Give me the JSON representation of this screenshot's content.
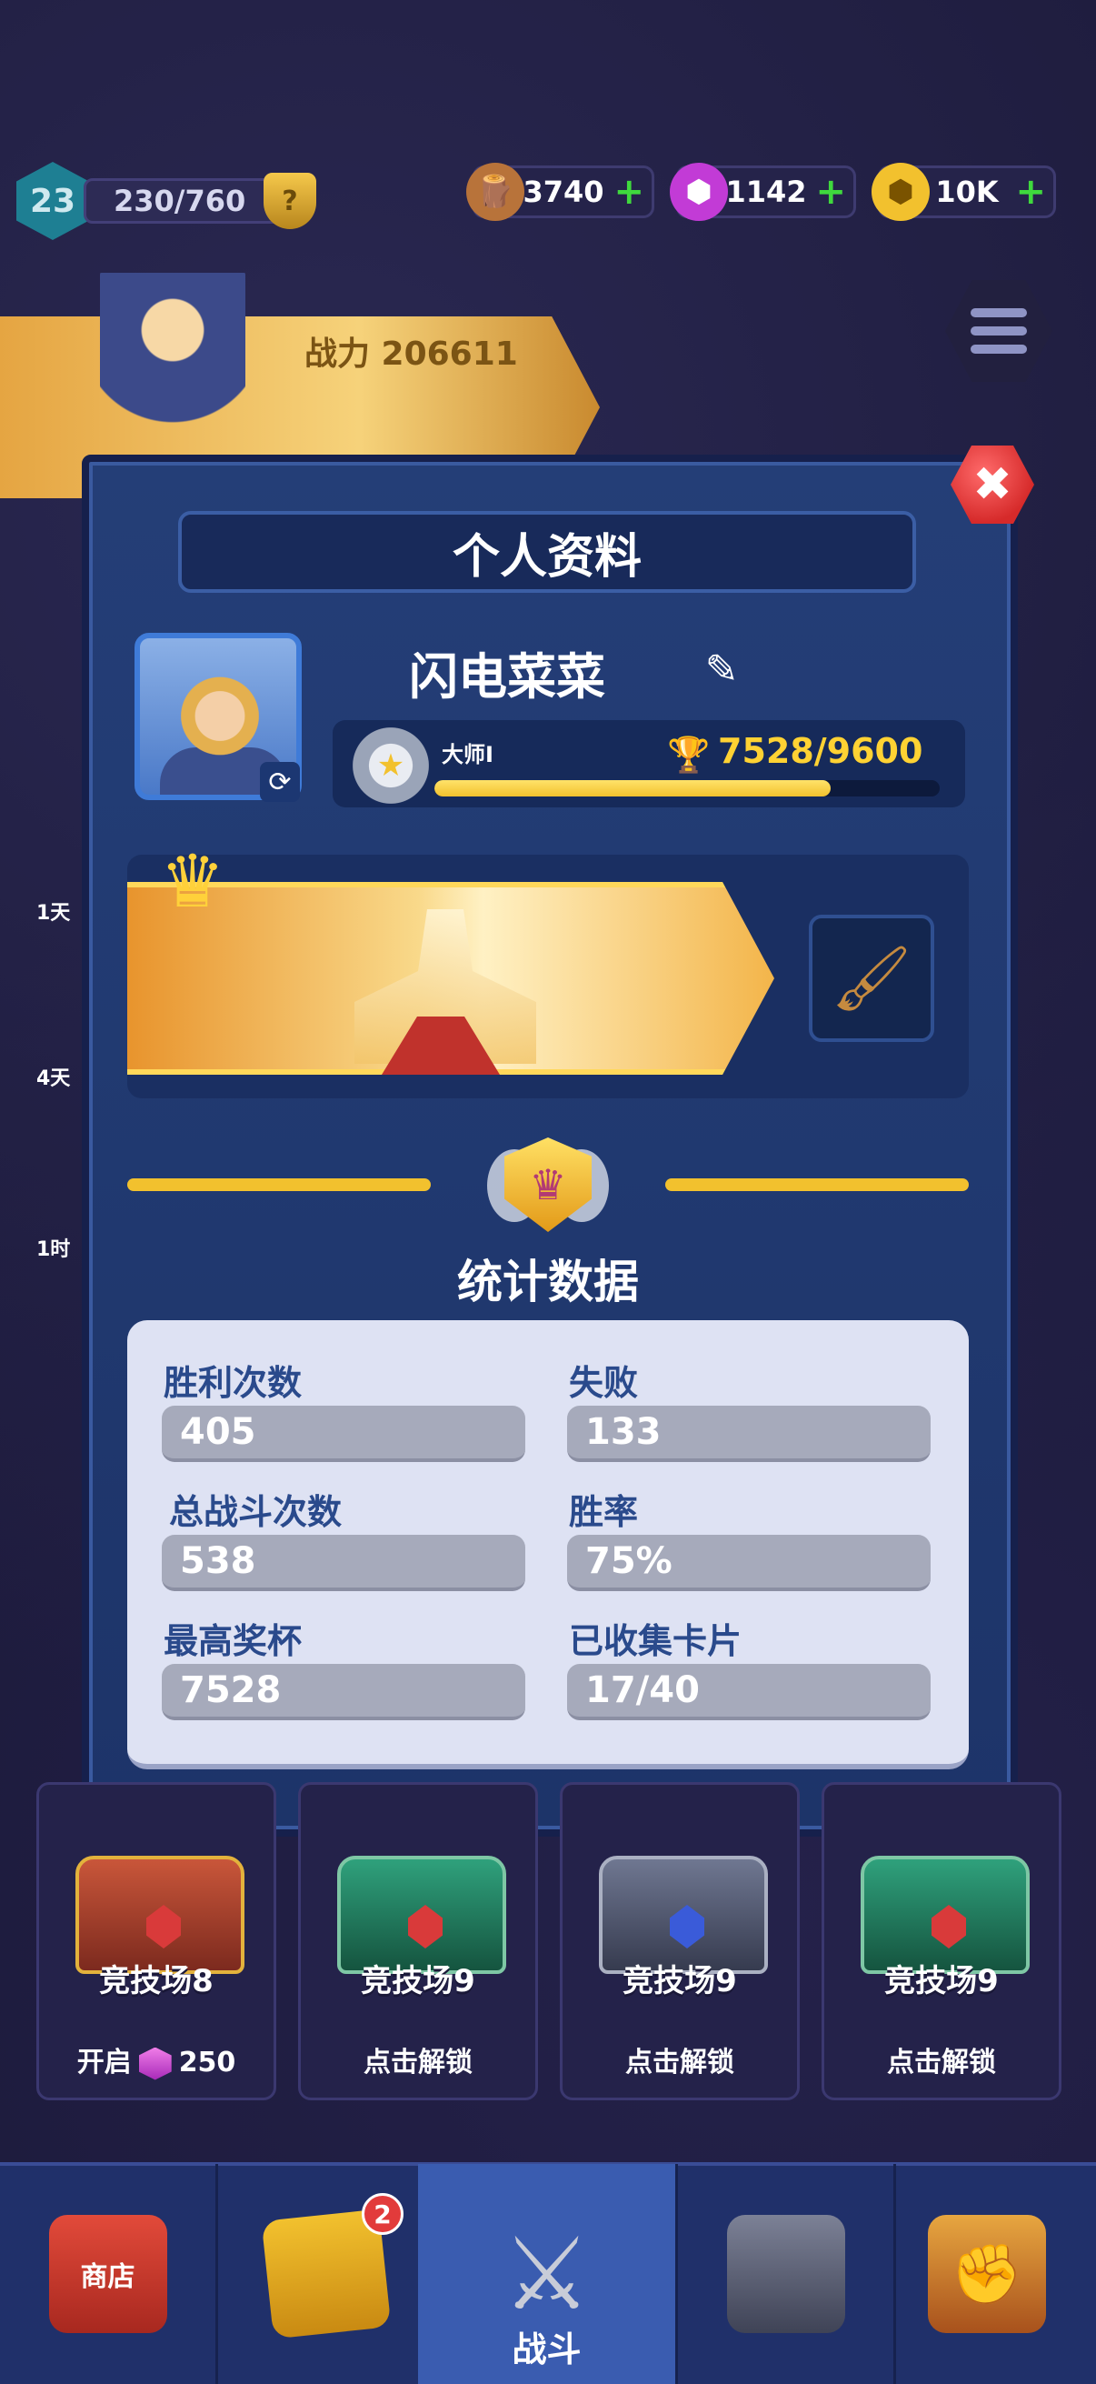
{
  "top_bar": {
    "level": "23",
    "xp": "230/760",
    "xp_shield_glyph": "?",
    "resources": [
      {
        "name": "wood",
        "value": "3740",
        "icon": "wood-log-icon",
        "color": "#b8733a"
      },
      {
        "name": "gems",
        "value": "1142",
        "icon": "purple-gem-icon",
        "color": "#c23bd6"
      },
      {
        "name": "coins",
        "value": "10K",
        "icon": "gold-coin-icon",
        "color": "#f2c12e"
      }
    ]
  },
  "background": {
    "power_label": "战力 206611",
    "side_labels": [
      "1天",
      "4天",
      "1时"
    ]
  },
  "modal": {
    "title": "个人资料",
    "close_glyph": "✖",
    "player_name": "闪电菜菜",
    "rank": {
      "name": "大师Ⅰ",
      "trophies": "7528/9600",
      "progress": 0.784
    },
    "stats_title": "统计数据",
    "stats": [
      {
        "label": "胜利次数",
        "value": "405"
      },
      {
        "label": "失败",
        "value": "133"
      },
      {
        "label": "总战斗次数",
        "value": "538"
      },
      {
        "label": "胜率",
        "value": "75%"
      },
      {
        "label": "最高奖杯",
        "value": "7528"
      },
      {
        "label": "已收集卡片",
        "value": "17/40"
      }
    ]
  },
  "chests": [
    {
      "name": "竞技场8",
      "action_prefix": "开启",
      "action_cost": "250",
      "color": "#a8462e"
    },
    {
      "name": "竞技场9",
      "action": "点击解锁",
      "color": "#2f8a6a"
    },
    {
      "name": "竞技场9",
      "action": "点击解锁",
      "color": "#5b6278"
    },
    {
      "name": "竞技场9",
      "action": "点击解锁",
      "color": "#2f8a6a"
    }
  ],
  "bottom_nav": {
    "shop_label": "商店",
    "cards_badge": "2",
    "battle_label": "战斗"
  }
}
